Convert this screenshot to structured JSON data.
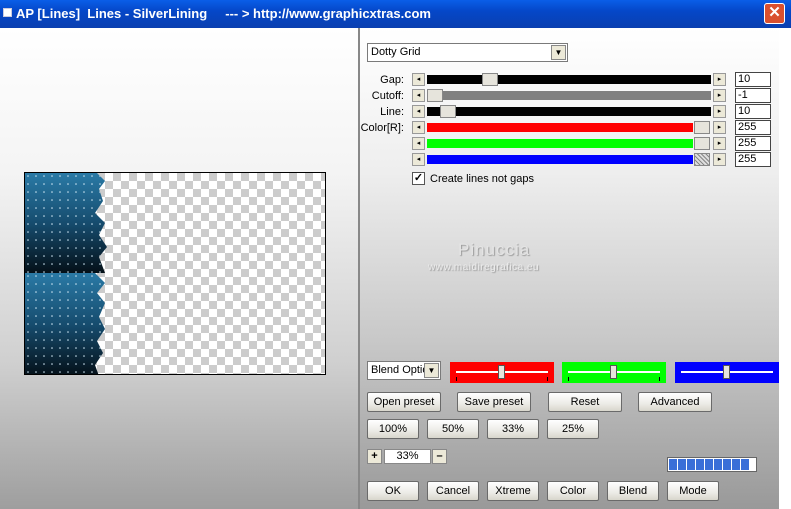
{
  "window": {
    "title": "AP [Lines]  Lines - SilverLining     --- > http://www.graphicxtras.com",
    "close_glyph": "✕"
  },
  "preset": {
    "selected": "Dotty Grid"
  },
  "sliders": {
    "gap": {
      "label": "Gap:",
      "value": "10",
      "level": 0.12
    },
    "cutoff": {
      "label": "Cutoff:",
      "value": "-1",
      "level": 0.0
    },
    "line": {
      "label": "Line:",
      "value": "10",
      "level": 0.05
    },
    "color_r": {
      "label": "Color[R]:",
      "value": "255",
      "level": 1.0,
      "color": "#ff0000"
    },
    "color_g": {
      "label": "",
      "value": "255",
      "level": 1.0,
      "color": "#00ff00"
    },
    "color_b": {
      "label": "",
      "value": "255",
      "level": 1.0,
      "color": "#0000ff"
    }
  },
  "checkbox": {
    "label": "Create lines not gaps",
    "checked": true,
    "mark": "✓"
  },
  "watermark": {
    "line1": "Pinuccia",
    "line2": "www.maidiregrafica.eu"
  },
  "blend": {
    "selected": "Blend Optio"
  },
  "color_bars": [
    {
      "name": "red",
      "color": "#ff0000",
      "level": 0.48
    },
    {
      "name": "green",
      "color": "#00ff00",
      "level": 0.48
    },
    {
      "name": "blue",
      "color": "#0000ff",
      "level": 0.48
    }
  ],
  "buttons": {
    "open_preset": "Open preset",
    "save_preset": "Save preset",
    "reset": "Reset",
    "advanced": "Advanced",
    "zoom100": "100%",
    "zoom50": "50%",
    "zoom33": "33%",
    "zoom25": "25%",
    "ok": "OK",
    "cancel": "Cancel",
    "xtreme": "Xtreme",
    "color": "Color",
    "blend": "Blend",
    "mode": "Mode"
  },
  "zoom": {
    "plus": "+",
    "minus": "–",
    "value": "33%"
  },
  "progress": {
    "segments": 9
  },
  "colors": {
    "titlebar": "#0547c8",
    "preview_teal": "#1f6a92"
  }
}
